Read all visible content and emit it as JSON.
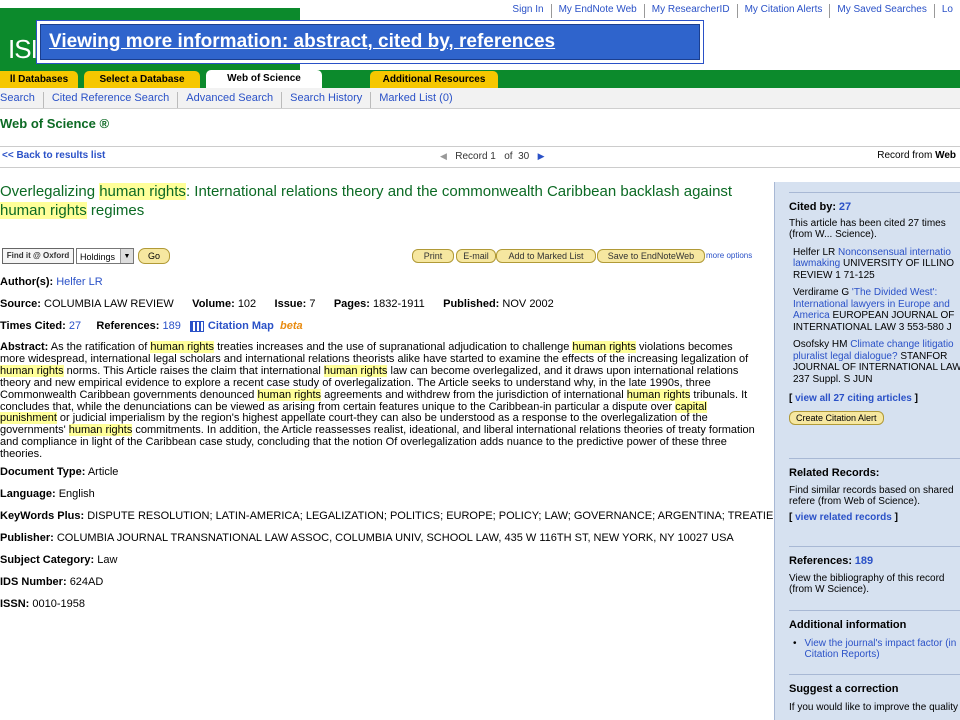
{
  "top_links": [
    "Sign In",
    "My EndNote Web",
    "My ResearcherID",
    "My Citation Alerts",
    "My Saved Searches",
    "Lo"
  ],
  "logo": "ISI",
  "banner": "Viewing more information: abstract, cited by, references",
  "tabs": [
    {
      "label": "ll Databases",
      "active": false
    },
    {
      "label": "Select a Database",
      "active": false
    },
    {
      "label": "Web of Science",
      "active": true
    },
    {
      "label": "Additional Resources",
      "active": false
    }
  ],
  "subnav": [
    "Search",
    "Cited Reference Search",
    "Advanced Search",
    "Search History",
    "Marked List (0)"
  ],
  "section_title": "Web of Science",
  "registered_mark": "®",
  "nav": {
    "back": "<< Back to results list",
    "record_label": "Record",
    "record_num": "1",
    "of_label": "of",
    "record_total": "30",
    "record_from": "Record from ",
    "record_from_source": "Web"
  },
  "article": {
    "title_parts": [
      {
        "t": "Overlegalizing ",
        "hl": false
      },
      {
        "t": "human rights",
        "hl": true
      },
      {
        "t": ": International relations theory and the commonwealth Caribbean backlash against ",
        "hl": false
      },
      {
        "t": "human rights",
        "hl": true
      },
      {
        "t": " regimes",
        "hl": false
      }
    ]
  },
  "buttons": {
    "find_it": "Find it @ Oxford",
    "holdings": "Holdings",
    "go": "Go",
    "print": "Print",
    "email": "E-mail",
    "add_marked": "Add to Marked List",
    "save_endnote": "Save to EndNoteWeb",
    "more_options": "more options"
  },
  "fields": {
    "authors_label": "Author(s):",
    "authors": "Helfer LR",
    "source_label": "Source:",
    "source": "COLUMBIA LAW REVIEW",
    "volume_label": "Volume:",
    "volume": "102",
    "issue_label": "Issue:",
    "issue": "7",
    "pages_label": "Pages:",
    "pages": "1832-1911",
    "published_label": "Published:",
    "published": "NOV 2002",
    "times_cited_label": "Times Cited:",
    "times_cited": "27",
    "references_label": "References:",
    "references": "189",
    "citation_map": "Citation Map",
    "beta": "beta",
    "abstract_label": "Abstract:",
    "abstract_parts": [
      {
        "t": "As the ratification of ",
        "hl": false
      },
      {
        "t": "human rights",
        "hl": true
      },
      {
        "t": " treaties increases and the use of supranational adjudication to challenge ",
        "hl": false
      },
      {
        "t": "human rights",
        "hl": true
      },
      {
        "t": " violations becomes more widespread, international legal scholars and international relations theorists alike have started to examine the effects of the increasing legalization of ",
        "hl": false
      },
      {
        "t": "human rights",
        "hl": true
      },
      {
        "t": " norms. This Article raises the claim that international ",
        "hl": false
      },
      {
        "t": "human rights",
        "hl": true
      },
      {
        "t": " law can become overlegalized, and it draws upon international relations theory and new empirical evidence to explore a recent case study of overlegalization. The Article seeks to understand why, in the late 1990s, three Commonwealth Caribbean governments denounced ",
        "hl": false
      },
      {
        "t": "human rights",
        "hl": true
      },
      {
        "t": " agreements and withdrew from the jurisdiction of international ",
        "hl": false
      },
      {
        "t": "human rights",
        "hl": true
      },
      {
        "t": " tribunals. It concludes that, while the denunciations can be viewed as arising from certain features unique to the Caribbean-in particular a dispute over ",
        "hl": false
      },
      {
        "t": "capital punishment",
        "hl": true
      },
      {
        "t": " or judicial imperialism by the region's highest appellate court-they can also be understood as a response to the overlegalization of the governments' ",
        "hl": false
      },
      {
        "t": "human rights",
        "hl": true
      },
      {
        "t": " commitments. In addition, the Article reassesses realist, ideational, and liberal international relations theories of treaty formation and compliance in light of the Caribbean case study, concluding that the notion Of overlegalization adds nuance to the predictive power of these three theories.",
        "hl": false
      }
    ],
    "doctype_label": "Document Type:",
    "doctype": "Article",
    "language_label": "Language:",
    "language": "English",
    "keywords_label": "KeyWords Plus:",
    "keywords": "DISPUTE RESOLUTION; LATIN-AMERICA; LEGALIZATION; POLITICS; EUROPE; POLICY; LAW; GOVERNANCE; ARGENTINA; TREATIES",
    "publisher_label": "Publisher:",
    "publisher": "COLUMBIA JOURNAL TRANSNATIONAL LAW ASSOC, COLUMBIA UNIV, SCHOOL LAW, 435 W 116TH ST, NEW YORK, NY 10027 USA",
    "subject_label": "Subject Category:",
    "subject": "Law",
    "ids_label": "IDS Number:",
    "ids": "624AD",
    "issn_label": "ISSN:",
    "issn": "0010-1958"
  },
  "sidebar": {
    "cited_by_label": "Cited by:",
    "cited_by_count": "27",
    "cited_by_text": "This article has been cited 27 times (from W... Science).",
    "citations": [
      {
        "author": "Helfer LR",
        "title": "Nonconsensual internatio lawmaking",
        "rest": "UNIVERSITY OF ILLINO REVIEW 1 71-125"
      },
      {
        "author": "Verdirame G",
        "title": "'The Divided West': International lawyers in Europe and America",
        "rest": "EUROPEAN JOURNAL OF INTERNATIONAL LAW 3 553-580 J"
      },
      {
        "author": "Osofsky HM",
        "title": "Climate change litigatio pluralist legal dialogue?",
        "rest": "STANFOR JOURNAL OF INTERNATIONAL LAW 237 Suppl. S JUN"
      }
    ],
    "view_all": "view all 27 citing articles",
    "create_alert": "Create Citation Alert",
    "related_label": "Related Records:",
    "related_text": "Find similar records based on shared refere (from Web of Science).",
    "view_related": "view related records",
    "references_label": "References:",
    "references_count": "189",
    "references_text": "View the bibliography of this record (from W Science).",
    "additional_label": "Additional information",
    "impact_link": "View the journal's impact factor (in Citation Reports)",
    "suggest_label": "Suggest a correction",
    "suggest_text": "If you would like to improve the quality"
  }
}
